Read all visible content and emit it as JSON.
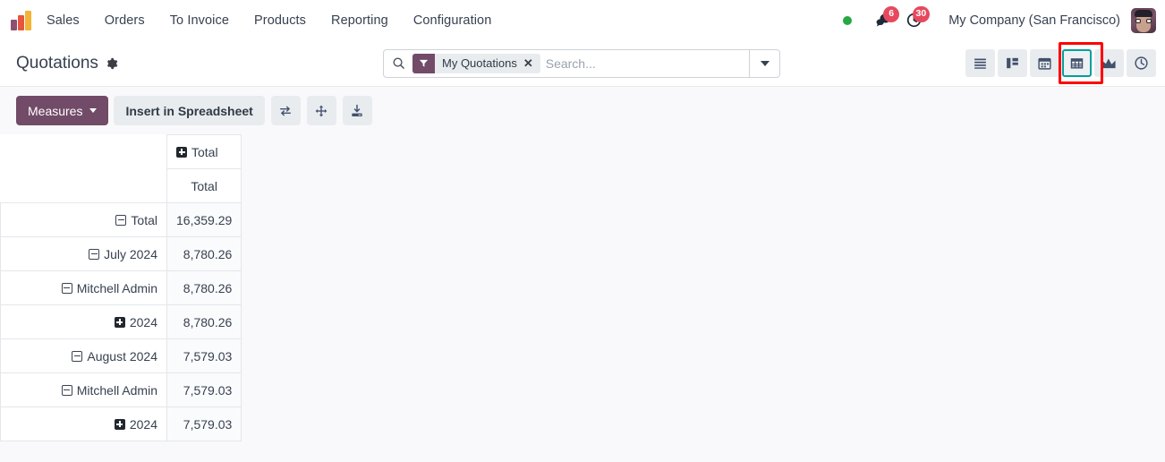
{
  "navbar": {
    "logo_name": "odoo-logo",
    "app_name": "Sales",
    "menu": [
      "Orders",
      "To Invoice",
      "Products",
      "Reporting",
      "Configuration"
    ],
    "status_indicator": "online-dot",
    "messages_badge": "6",
    "activities_badge": "30",
    "company": "My Company (San Francisco)",
    "avatar_name": "user-avatar"
  },
  "control_panel": {
    "title": "Quotations",
    "gear_icon": "gear-icon",
    "search": {
      "icon": "search-icon",
      "facet_icon": "filter-icon",
      "facet_label": "My Quotations",
      "facet_remove": "✕",
      "placeholder": "Search...",
      "value": "",
      "dropdown_icon": "chevron-down-icon"
    },
    "views": [
      {
        "name": "list-view",
        "icon": "list-icon",
        "active": false
      },
      {
        "name": "kanban-view",
        "icon": "kanban-icon",
        "active": false
      },
      {
        "name": "calendar-view",
        "icon": "calendar-icon",
        "active": false
      },
      {
        "name": "pivot-view",
        "icon": "pivot-icon",
        "active": true
      },
      {
        "name": "graph-view",
        "icon": "area-chart-icon",
        "active": false
      },
      {
        "name": "activity-view",
        "icon": "clock-icon",
        "active": false
      }
    ],
    "annotation_color": "#ff0000",
    "active_view_color": "#00a09d"
  },
  "pivot_toolbar": {
    "measures_label": "Measures",
    "insert_spreadsheet_label": "Insert in Spreadsheet",
    "flip_axis_icon": "flip-axis-icon",
    "expand_all_icon": "expand-all-icon",
    "download_icon": "download-xlsx-icon"
  },
  "pivot": {
    "column_header_top": "Total",
    "column_header_sub": "Total",
    "rows": [
      {
        "label": "Total",
        "indent": 0,
        "state": "minus",
        "value": "16,359.29"
      },
      {
        "label": "July 2024",
        "indent": 1,
        "state": "minus",
        "value": "8,780.26"
      },
      {
        "label": "Mitchell Admin",
        "indent": 2,
        "state": "minus",
        "value": "8,780.26"
      },
      {
        "label": "2024",
        "indent": 3,
        "state": "plus",
        "value": "8,780.26"
      },
      {
        "label": "August 2024",
        "indent": 1,
        "state": "minus",
        "value": "7,579.03"
      },
      {
        "label": "Mitchell Admin",
        "indent": 2,
        "state": "minus",
        "value": "7,579.03"
      },
      {
        "label": "2024",
        "indent": 3,
        "state": "plus",
        "value": "7,579.03"
      }
    ]
  },
  "chart_data": {
    "type": "table",
    "title": "Quotations pivot — Total",
    "categories": [
      "Total",
      "July 2024",
      "July 2024 / Mitchell Admin",
      "July 2024 / Mitchell Admin / 2024",
      "August 2024",
      "August 2024 / Mitchell Admin",
      "August 2024 / Mitchell Admin / 2024"
    ],
    "values": [
      16359.29,
      8780.26,
      8780.26,
      8780.26,
      7579.03,
      7579.03,
      7579.03
    ],
    "xlabel": "",
    "ylabel": "Total"
  }
}
